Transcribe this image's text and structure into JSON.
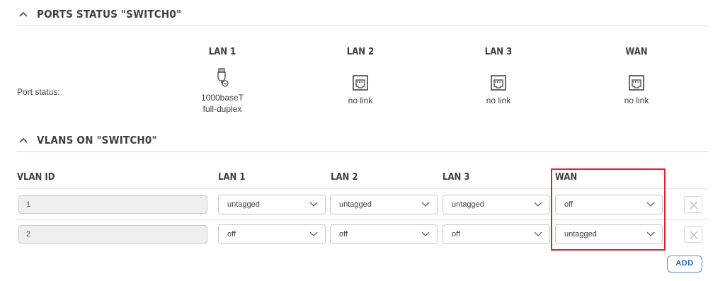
{
  "ports_section": {
    "title": "PORTS STATUS \"SWITCH0\"",
    "row_label": "Port status:",
    "ports": [
      {
        "name": "LAN 1",
        "icon": "ethernet-cable-connected-icon",
        "status_line1": "1000baseT",
        "status_line2": "full-duplex"
      },
      {
        "name": "LAN 2",
        "icon": "ethernet-port-icon",
        "status_line1": "no link",
        "status_line2": ""
      },
      {
        "name": "LAN 3",
        "icon": "ethernet-port-icon",
        "status_line1": "no link",
        "status_line2": ""
      },
      {
        "name": "WAN",
        "icon": "ethernet-port-icon",
        "status_line1": "no link",
        "status_line2": ""
      }
    ]
  },
  "vlans_section": {
    "title": "VLANS ON \"SWITCH0\"",
    "columns": [
      "VLAN ID",
      "LAN 1",
      "LAN 2",
      "LAN 3",
      "WAN"
    ],
    "rows": [
      {
        "vlan_id": "1",
        "lan1": "untagged",
        "lan2": "untagged",
        "lan3": "untagged",
        "wan": "off"
      },
      {
        "vlan_id": "2",
        "lan1": "off",
        "lan2": "off",
        "lan3": "off",
        "wan": "untagged"
      }
    ],
    "add_label": "ADD"
  },
  "colors": {
    "highlight": "#d9232e",
    "add_button": "#2f65b5",
    "text": "#404040"
  }
}
